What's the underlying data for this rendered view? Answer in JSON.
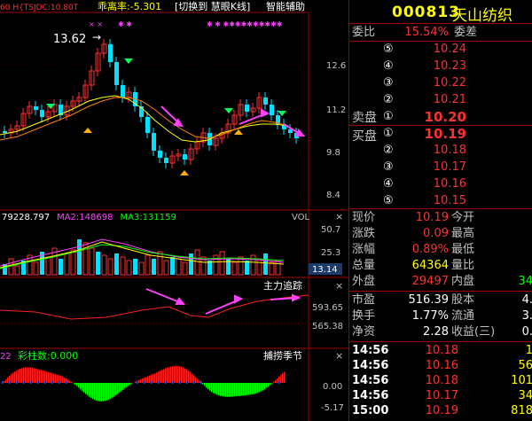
{
  "window": {
    "indicator_text": "乖离率:-5.301",
    "menu_switch": "[切换到 慧眼K线]",
    "menu_assist": "智能辅助",
    "left_partial": "60 H{TSJDC:10.80T"
  },
  "price_chart": {
    "high_label": "13.62",
    "axis_ticks": [
      "12.6",
      "11.2",
      "9.8",
      "8.4"
    ],
    "x_marks": "××"
  },
  "vol_chart": {
    "legend": [
      {
        "label": "79228.797",
        "color": "#ffffff"
      },
      {
        "label": "MA2:148698",
        "color": "#ff40ff"
      },
      {
        "label": "MA3:131159",
        "color": "#00ff00"
      }
    ],
    "title": "VOL",
    "axis_ticks": [
      "50.7",
      "25.3"
    ],
    "current": "13.14"
  },
  "track_chart": {
    "title": "主力追踪",
    "axis_ticks": [
      "593.65",
      "565.38"
    ]
  },
  "catch_chart": {
    "legend_prefix": "22",
    "legend": "彩柱数:0.000",
    "title": "捕捞季节",
    "axis_ticks": [
      "0.00",
      "-5.17"
    ]
  },
  "quote": {
    "code": "000813",
    "name": "天山纺织",
    "weibi_label": "委比",
    "weibi_value": "15.54%",
    "weicha_label": "委差",
    "sell_side_label": "卖盘",
    "buy_side_label": "买盘",
    "sells": [
      {
        "idx": "⑤",
        "price": "10.24"
      },
      {
        "idx": "④",
        "price": "10.23"
      },
      {
        "idx": "③",
        "price": "10.22"
      },
      {
        "idx": "②",
        "price": "10.21"
      },
      {
        "idx": "①",
        "price": "10.20"
      }
    ],
    "buys": [
      {
        "idx": "①",
        "price": "10.19"
      },
      {
        "idx": "②",
        "price": "10.18"
      },
      {
        "idx": "③",
        "price": "10.17"
      },
      {
        "idx": "④",
        "price": "10.16"
      },
      {
        "idx": "⑤",
        "price": "10.15"
      }
    ],
    "stats": [
      {
        "l1": "现价",
        "v1": "10.19",
        "c1": "#ff3030",
        "l2": "今开",
        "v2": ""
      },
      {
        "l1": "涨跌",
        "v1": "0.09",
        "c1": "#ff3030",
        "l2": "最高",
        "v2": ""
      },
      {
        "l1": "涨幅",
        "v1": "0.89%",
        "c1": "#ff3030",
        "l2": "最低",
        "v2": ""
      },
      {
        "l1": "总量",
        "v1": "64364",
        "c1": "#ffff00",
        "l2": "量比",
        "v2": ""
      },
      {
        "l1": "外盘",
        "v1": "29497",
        "c1": "#ff3030",
        "l2": "内盘",
        "v2": "34"
      }
    ],
    "fin": [
      {
        "l1": "市盈",
        "v1": "516.39",
        "l2": "股本",
        "v2": "4."
      },
      {
        "l1": "换手",
        "v1": "1.77%",
        "l2": "流通",
        "v2": "3."
      },
      {
        "l1": "净资",
        "v1": "2.28",
        "l2": "收益(三)",
        "v2": "0."
      }
    ],
    "ticks": [
      {
        "time": "14:56",
        "price": "10.18",
        "pc": "#ff3030",
        "vol": "1",
        "vc": "#ffff00"
      },
      {
        "time": "14:56",
        "price": "10.16",
        "pc": "#ff3030",
        "vol": "56",
        "vc": "#ffff00"
      },
      {
        "time": "14:56",
        "price": "10.18",
        "pc": "#ff3030",
        "vol": "101",
        "vc": "#ffff00"
      },
      {
        "time": "14:56",
        "price": "10.17",
        "pc": "#ff3030",
        "vol": "34",
        "vc": "#ffff00"
      },
      {
        "time": "15:00",
        "price": "10.19",
        "pc": "#ff3030",
        "vol": "818",
        "vc": "#ffff00"
      }
    ]
  }
}
